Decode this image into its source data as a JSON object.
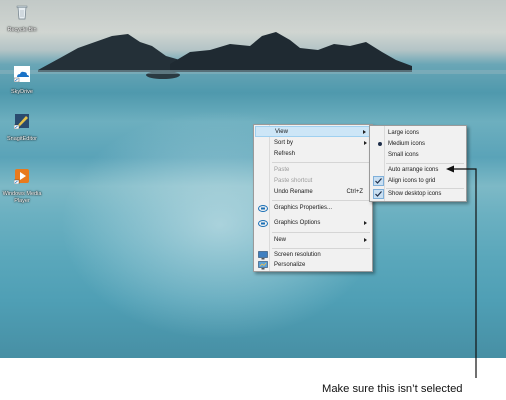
{
  "desktop_icons": [
    {
      "label": "Recycle Bin",
      "icon": "recycle-bin-icon"
    },
    {
      "label": "SkyDrive",
      "icon": "skydrive-icon"
    },
    {
      "label": "SnagitEditor",
      "icon": "snagit-editor-icon"
    },
    {
      "label": "Windows Media Player",
      "icon": "media-player-icon"
    }
  ],
  "context_menu": {
    "view": "View",
    "sort_by": "Sort by",
    "refresh": "Refresh",
    "paste": "Paste",
    "paste_shortcut": "Paste shortcut",
    "undo_rename": "Undo Rename",
    "undo_shortcut": "Ctrl+Z",
    "graphics_properties": "Graphics Properties...",
    "graphics_options": "Graphics Options",
    "new": "New",
    "screen_resolution": "Screen resolution",
    "personalize": "Personalize"
  },
  "view_submenu": {
    "large_icons": "Large icons",
    "medium_icons": "Medium icons",
    "small_icons": "Small icons",
    "auto_arrange": "Auto arrange icons",
    "align_to_grid": "Align icons to grid",
    "show_desktop_icons": "Show desktop icons",
    "selected_size": "Medium icons",
    "auto_arrange_checked": false,
    "align_to_grid_checked": true,
    "show_desktop_icons_checked": true
  },
  "callout": {
    "text": "Make sure this isn’t selected"
  },
  "colors": {
    "menu_bg": "#f1f1f1",
    "highlight": "#cde6f7",
    "check_bg": "#c9dff2",
    "intel_blue": "#1a6fb5"
  }
}
